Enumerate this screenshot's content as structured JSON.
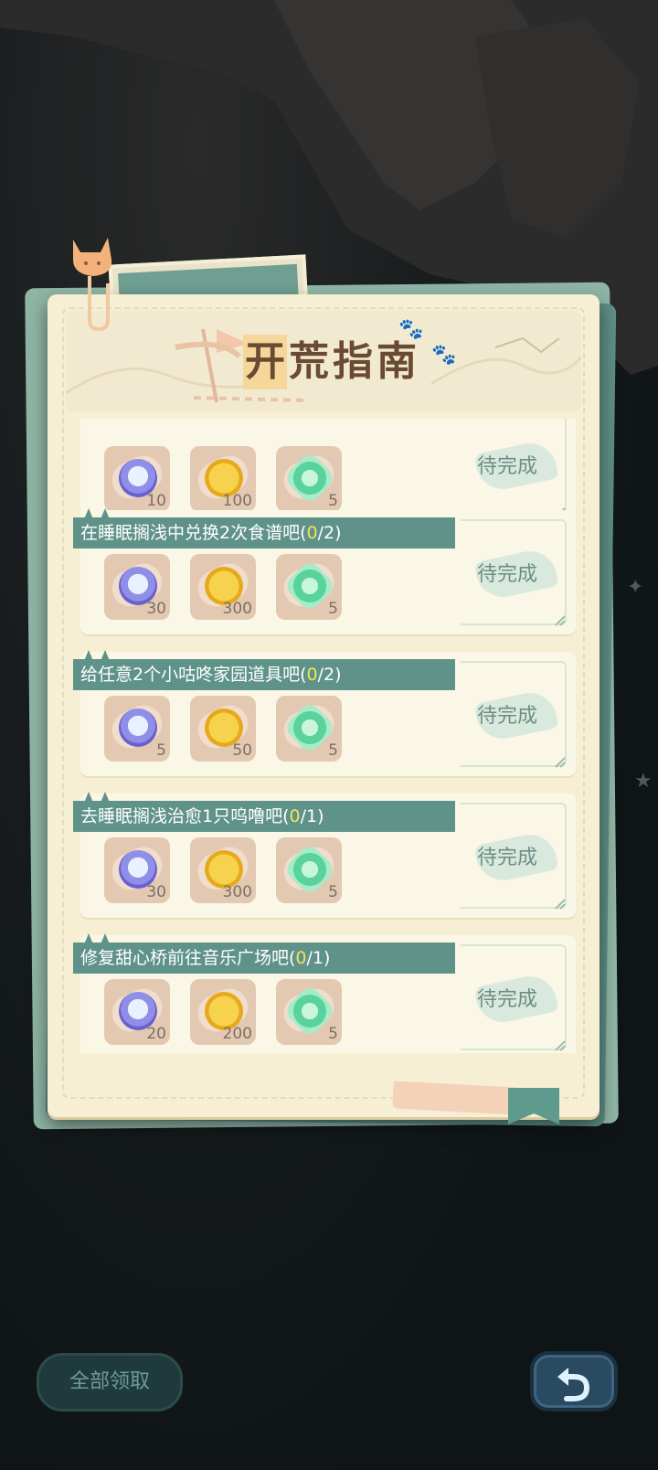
{
  "title": {
    "chars": [
      "开",
      "荒",
      "指",
      "南"
    ]
  },
  "tasks": [
    {
      "label_prefix": "",
      "progress": "",
      "label_suffix": "",
      "rewards": [
        {
          "icon": "moon-coin-icon",
          "count": "10"
        },
        {
          "icon": "gold-coin-icon",
          "count": "100"
        },
        {
          "icon": "green-gem-icon",
          "count": "5"
        }
      ],
      "status": "待完成"
    },
    {
      "label_prefix": "在睡眠搁浅中兑换2次食谱吧(",
      "progress": "0",
      "label_suffix": "/2)",
      "rewards": [
        {
          "icon": "moon-coin-icon",
          "count": "30"
        },
        {
          "icon": "gold-coin-icon",
          "count": "300"
        },
        {
          "icon": "green-gem-icon",
          "count": "5"
        }
      ],
      "status": "待完成"
    },
    {
      "label_prefix": "给任意2个小咕咚家园道具吧(",
      "progress": "0",
      "label_suffix": "/2)",
      "rewards": [
        {
          "icon": "moon-coin-icon",
          "count": "5"
        },
        {
          "icon": "gold-coin-icon",
          "count": "50"
        },
        {
          "icon": "green-gem-icon",
          "count": "5"
        }
      ],
      "status": "待完成"
    },
    {
      "label_prefix": "去睡眠搁浅治愈1只呜噜吧(",
      "progress": "0",
      "label_suffix": "/1)",
      "rewards": [
        {
          "icon": "moon-coin-icon",
          "count": "30"
        },
        {
          "icon": "gold-coin-icon",
          "count": "300"
        },
        {
          "icon": "green-gem-icon",
          "count": "5"
        }
      ],
      "status": "待完成"
    },
    {
      "label_prefix": "修复甜心桥前往音乐广场吧(",
      "progress": "0",
      "label_suffix": "/1)",
      "rewards": [
        {
          "icon": "moon-coin-icon",
          "count": "20"
        },
        {
          "icon": "gold-coin-icon",
          "count": "200"
        },
        {
          "icon": "green-gem-icon",
          "count": "5"
        }
      ],
      "status": "待完成"
    }
  ],
  "buttons": {
    "claim_all": "全部领取",
    "back_icon": "undo-arrow-icon"
  },
  "colors": {
    "banner": "#5f9389",
    "progress_highlight": "#f1e45a",
    "status_text": "#6c8e86"
  }
}
